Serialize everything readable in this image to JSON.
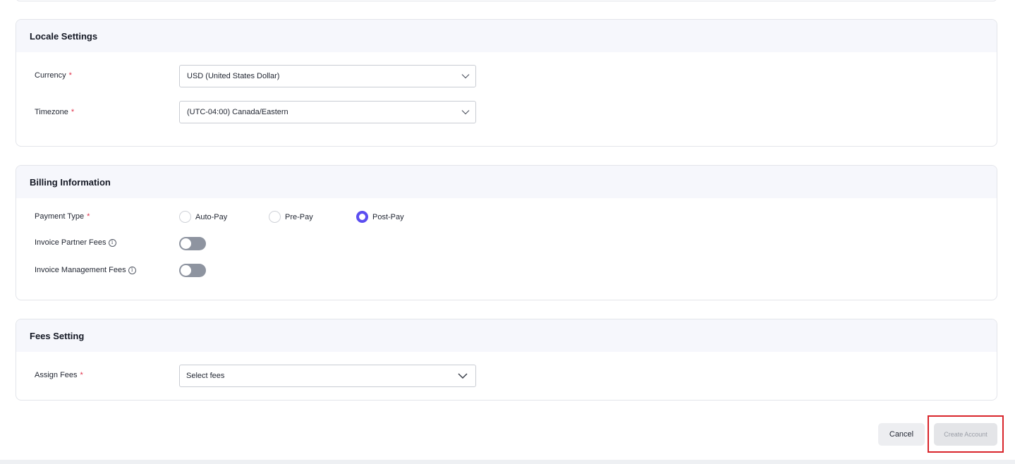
{
  "locale": {
    "title": "Locale Settings",
    "currency_label": "Currency",
    "currency_value": "USD (United States Dollar)",
    "timezone_label": "Timezone",
    "timezone_value": "(UTC-04:00) Canada/Eastern"
  },
  "billing": {
    "title": "Billing Information",
    "payment_type_label": "Payment Type",
    "payment_options": [
      "Auto-Pay",
      "Pre-Pay",
      "Post-Pay"
    ],
    "selected_payment": "Post-Pay",
    "partner_fees_label": "Invoice Partner Fees",
    "partner_fees_enabled": false,
    "management_fees_label": "Invoice Management Fees",
    "management_fees_enabled": false
  },
  "fees": {
    "title": "Fees Setting",
    "assign_label": "Assign Fees",
    "assign_placeholder": "Select fees"
  },
  "actions": {
    "cancel_label": "Cancel",
    "create_label": "Create Account"
  },
  "required_mark": "*",
  "colors": {
    "accent": "#5b4ef0",
    "required": "#e0304a",
    "highlight": "#d9252b"
  }
}
